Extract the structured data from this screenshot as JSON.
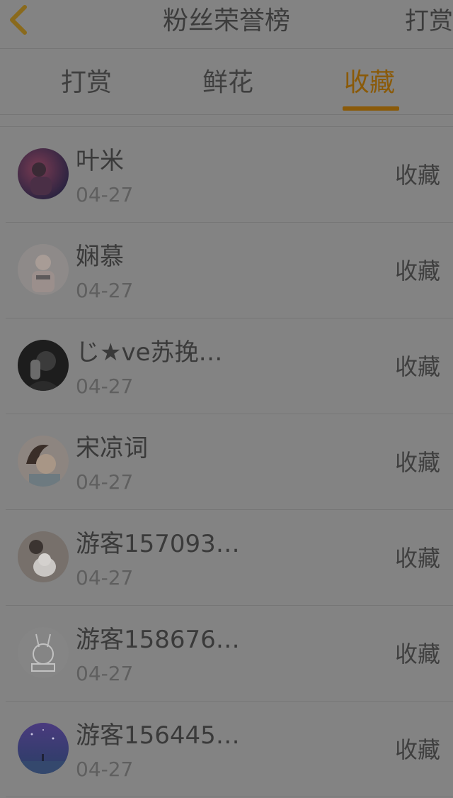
{
  "header": {
    "title": "粉丝荣誉榜",
    "right_action": "打赏",
    "back_icon": "chevron-left-icon",
    "accent_color": "#8a5a09"
  },
  "tabs": [
    {
      "label": "打赏",
      "active": false
    },
    {
      "label": "鲜花",
      "active": false
    },
    {
      "label": "收藏",
      "active": true
    }
  ],
  "fans": [
    {
      "name": "叶米",
      "date": "04-27",
      "action": "收藏"
    },
    {
      "name": "娴慕",
      "date": "04-27",
      "action": "收藏"
    },
    {
      "name": "じ★ve苏挽…",
      "date": "04-27",
      "action": "收藏"
    },
    {
      "name": "宋凉词",
      "date": "04-27",
      "action": "收藏"
    },
    {
      "name": "游客157093…",
      "date": "04-27",
      "action": "收藏"
    },
    {
      "name": "游客158676…",
      "date": "04-27",
      "action": "收藏"
    },
    {
      "name": "游客156445…",
      "date": "04-27",
      "action": "收藏"
    }
  ]
}
